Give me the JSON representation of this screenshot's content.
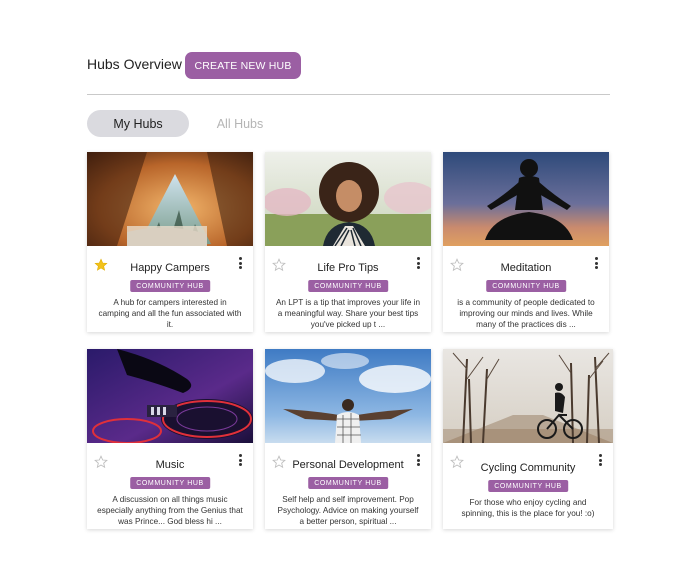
{
  "header": {
    "title": "Hubs Overview",
    "create_button": "CREATE NEW HUB"
  },
  "tabs": [
    {
      "label": "My Hubs",
      "active": true
    },
    {
      "label": "All Hubs",
      "active": false
    }
  ],
  "colors": {
    "accent": "#9b5fa3",
    "tab_active_bg": "#dadadf",
    "star_filled": "#f2c21b",
    "star_empty": "#bdbdbd"
  },
  "hubs": [
    {
      "title": "Happy Campers",
      "badge": "COMMUNITY HUB",
      "favorited": true,
      "image": "tent-camping-photo",
      "description": "A hub for campers interested in camping and all the fun associated with it."
    },
    {
      "title": "Life Pro Tips",
      "badge": "COMMUNITY HUB",
      "favorited": false,
      "image": "smiling-woman-photo",
      "description": "An LPT is a tip that improves your life in a meaningful way. Share your best tips you've picked up t ..."
    },
    {
      "title": "Meditation",
      "badge": "COMMUNITY HUB",
      "favorited": false,
      "image": "meditation-silhouette-photo",
      "description": "is a community of people dedicated to improving our minds and lives. While many of the practices dis ..."
    },
    {
      "title": "Music",
      "badge": "COMMUNITY HUB",
      "favorited": false,
      "image": "dj-turntable-photo",
      "description": "A discussion on all things music especially anything from the Genius that was Prince... God bless hi ..."
    },
    {
      "title": "Personal Development",
      "badge": "COMMUNITY HUB",
      "favorited": false,
      "image": "man-arms-open-sky-photo",
      "description": "Self help and self improvement. Pop Psychology. Advice on making yourself a better person, spiritual ..."
    },
    {
      "title": "Cycling Community",
      "badge": "COMMUNITY HUB",
      "favorited": false,
      "image": "cyclist-road-photo",
      "description": "For those who enjoy cycling and spinning, this is the place for you! :o)"
    }
  ]
}
